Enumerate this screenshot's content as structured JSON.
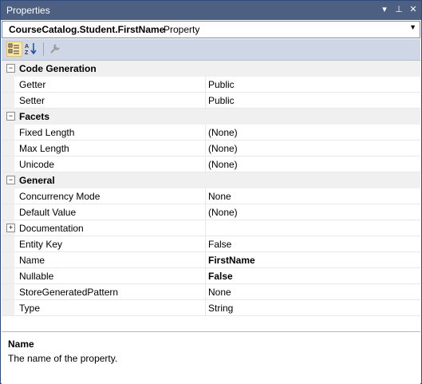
{
  "window": {
    "title": "Properties",
    "buttons": {
      "dropdown": "▾",
      "pin": "⊥",
      "close": "✕"
    }
  },
  "object_selector": {
    "name": "CourseCatalog.Student.FirstName",
    "type": "Property"
  },
  "toolbar": {
    "items": [
      {
        "icon": "categorized-icon",
        "active": true
      },
      {
        "icon": "alphabetical-icon",
        "active": false
      },
      {
        "icon": "property-pages-icon",
        "active": false
      }
    ]
  },
  "categories": [
    {
      "label": "Code Generation",
      "properties": [
        {
          "name": "Getter",
          "value": "Public"
        },
        {
          "name": "Setter",
          "value": "Public"
        }
      ]
    },
    {
      "label": "Facets",
      "properties": [
        {
          "name": "Fixed Length",
          "value": "(None)"
        },
        {
          "name": "Max Length",
          "value": "(None)"
        },
        {
          "name": "Unicode",
          "value": "(None)"
        }
      ]
    },
    {
      "label": "General",
      "properties": [
        {
          "name": "Concurrency Mode",
          "value": "None"
        },
        {
          "name": "Default Value",
          "value": "(None)"
        },
        {
          "name": "Documentation",
          "value": ""
        },
        {
          "name": "Entity Key",
          "value": "False"
        },
        {
          "name": "Name",
          "value": "FirstName"
        },
        {
          "name": "Nullable",
          "value": "False"
        },
        {
          "name": "StoreGeneratedPattern",
          "value": "None"
        },
        {
          "name": "Type",
          "value": "String"
        }
      ]
    }
  ],
  "description": {
    "title": "Name",
    "text": "The name of the property."
  }
}
